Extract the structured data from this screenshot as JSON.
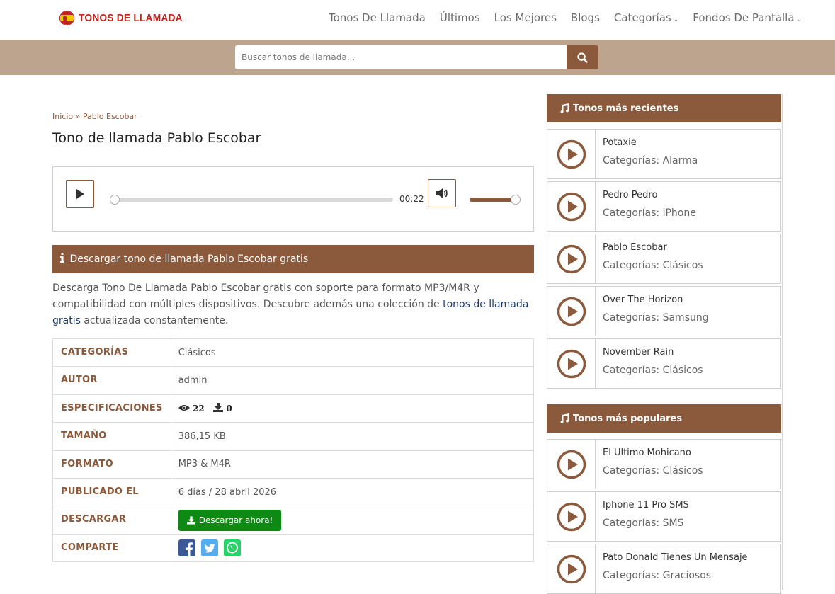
{
  "header": {
    "logo_text": "TONOS DE LLAMADA",
    "nav": [
      {
        "label": "Tonos De Llamada",
        "dropdown": false
      },
      {
        "label": "Últimos",
        "dropdown": false
      },
      {
        "label": "Los Mejores",
        "dropdown": false
      },
      {
        "label": "Blogs",
        "dropdown": false
      },
      {
        "label": "Categorías",
        "dropdown": true
      },
      {
        "label": "Fondos De Pantalla",
        "dropdown": true
      }
    ]
  },
  "search": {
    "placeholder": "Buscar tonos de llamada..."
  },
  "breadcrumb": {
    "home": "Inicio",
    "sep": "»",
    "current": "Pablo Escobar"
  },
  "page_title": "Tono de llamada Pablo Escobar",
  "player": {
    "time": "00:22",
    "progress": 0.0,
    "volume": 1.0
  },
  "download_section": {
    "heading": "Descargar tono de llamada Pablo Escobar gratis",
    "desc_before": "Descarga Tono De Llamada Pablo Escobar gratis con soporte para formato MP3/M4R y compatibilidad con múltiples dispositivos. Descubre además una colección de ",
    "desc_link": "tonos de llamada gratis",
    "desc_after": " actualizada constantemente."
  },
  "details": {
    "categorias_label": "CATEGORÍAS",
    "categorias_value": "Clásicos",
    "autor_label": "AUTOR",
    "autor_value": "admin",
    "spec_label": "ESPECIFICACIONES",
    "views": "22",
    "downloads": "0",
    "tamano_label": "TAMAÑO",
    "tamano_value": "386,15 KB",
    "formato_label": "FORMATO",
    "formato_value": "MP3 & M4R",
    "publicado_label": "PUBLICADO EL",
    "publicado_value": "6 días / 28 abril 2026",
    "descargar_label": "DESCARGAR",
    "descargar_button": "Descargar ahora!",
    "comparte_label": "COMPARTE"
  },
  "sidebar": {
    "recent_title": "Tonos más recientes",
    "recent": [
      {
        "name": "Potaxie",
        "category": "Categorías: Alarma"
      },
      {
        "name": "Pedro Pedro",
        "category": "Categorías: iPhone"
      },
      {
        "name": "Pablo Escobar",
        "category": "Categorías: Clásicos"
      },
      {
        "name": "Over The Horizon",
        "category": "Categorías: Samsung"
      },
      {
        "name": "November Rain",
        "category": "Categorías: Clásicos"
      }
    ],
    "popular_title": "Tonos más populares",
    "popular": [
      {
        "name": "El Ultimo Mohicano",
        "category": "Categorías: Clásicos"
      },
      {
        "name": "Iphone 11 Pro SMS",
        "category": "Categorías: SMS"
      },
      {
        "name": "Pato Donald Tienes Un Mensaje",
        "category": "Categorías: Graciosos"
      }
    ]
  },
  "colors": {
    "brand": "#8b5a3c",
    "band": "#bda48f",
    "download_green": "#0d8a13",
    "logo_red": "#c0241b"
  }
}
